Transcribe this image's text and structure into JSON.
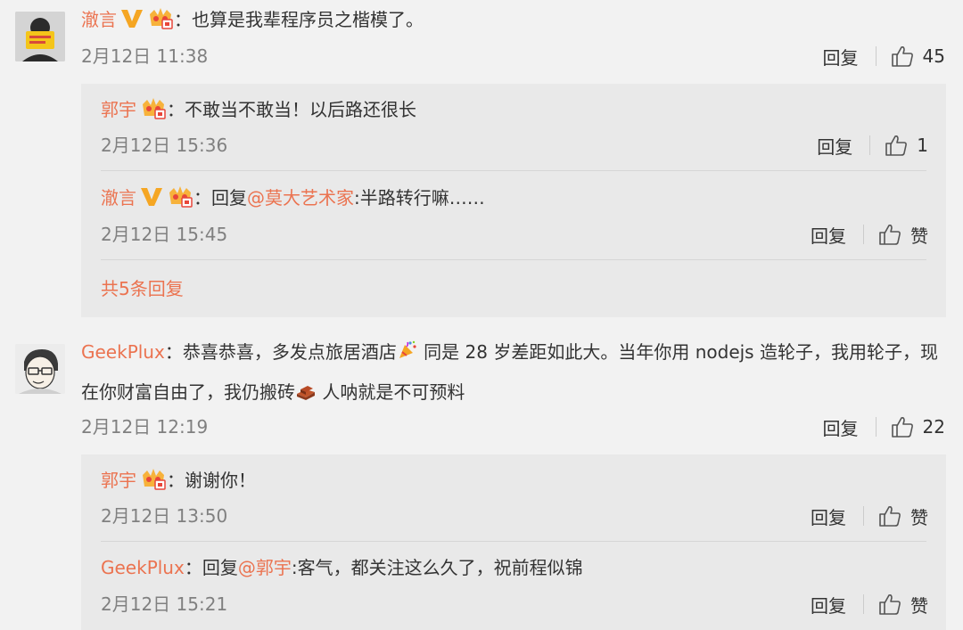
{
  "thread": {
    "comments": [
      {
        "author": "澈言",
        "text": "：也算是我辈程序员之楷模了。",
        "time": "2月12日 11:38",
        "reply_label": "回复",
        "likes": "45",
        "replies": [
          {
            "author": "郭宇",
            "prefix": "",
            "at": "",
            "text": "：不敢当不敢当！以后路还很长",
            "time": "2月12日 15:36",
            "reply_label": "回复",
            "likes": "1"
          },
          {
            "author": "澈言",
            "prefix": "：回复",
            "at": "@莫大艺术家",
            "text": ":半路转行嘛……",
            "time": "2月12日 15:45",
            "reply_label": "回复",
            "likes": "赞"
          }
        ],
        "more_label": "共5条回复"
      },
      {
        "author": "GeekPlux",
        "text_part1": "：恭喜恭喜，多发点旅居酒店",
        "text_part2": " 同是 28 岁差距如此大。当年你用 nodejs 造轮子，我用轮子，现在你财富自由了，我仍搬砖",
        "text_part3": " 人呐就是不可预料",
        "time": "2月12日 12:19",
        "reply_label": "回复",
        "likes": "22",
        "replies": [
          {
            "author": "郭宇",
            "prefix": "",
            "at": "",
            "text": "：谢谢你！",
            "time": "2月12日 13:50",
            "reply_label": "回复",
            "likes": "赞"
          },
          {
            "author": "GeekPlux",
            "prefix": "：回复",
            "at": "@郭宇",
            "text": ":客气，都关注这么久了，祝前程似锦",
            "time": "2月12日 15:21",
            "reply_label": "回复",
            "likes": "赞"
          }
        ]
      }
    ]
  },
  "colors": {
    "accent": "#eb7350",
    "text": "#333333",
    "meta": "#808080",
    "background": "#f2f2f2",
    "reply_background": "#e9e9e9",
    "verified": "#f5a623"
  },
  "icons": {
    "verified": "verified-v-icon",
    "member": "vip-crown-icon",
    "like": "thumbs-up-icon",
    "party": "party-popper-emoji",
    "brick": "brick-emoji"
  }
}
